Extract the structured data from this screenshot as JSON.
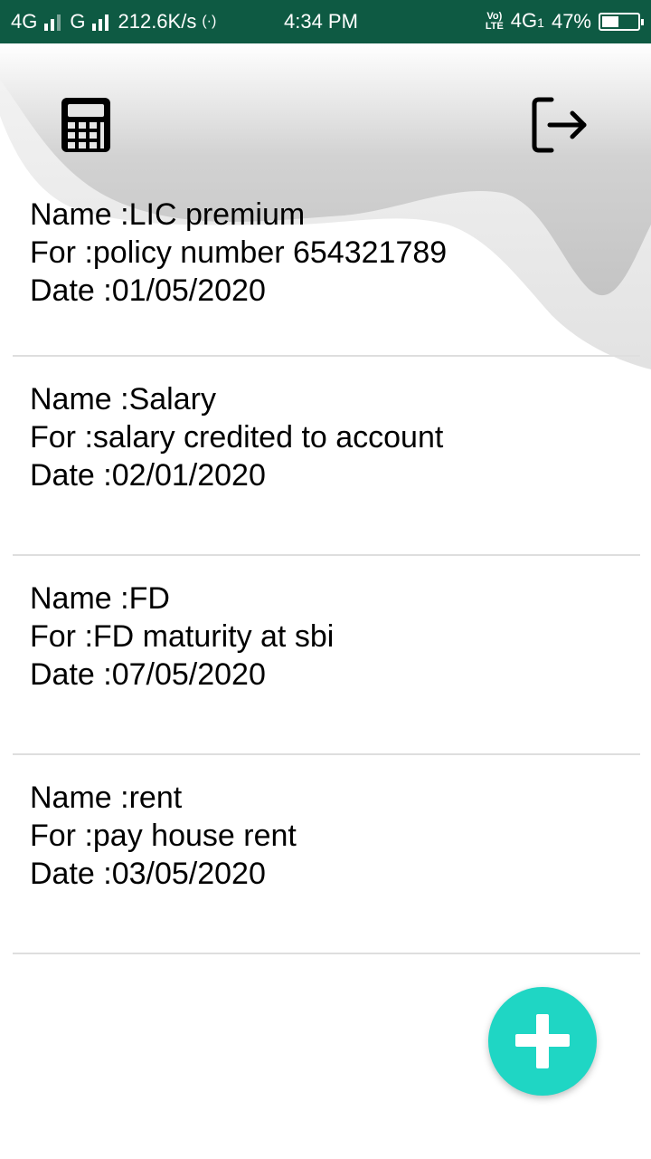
{
  "status_bar": {
    "left_network_1": "4G",
    "left_network_2": "G",
    "speed": "212.6K/s",
    "hotspot": "(·)",
    "time": "4:34 PM",
    "volte_top": "Vo)",
    "volte_bottom": "LTE",
    "right_network": "4G",
    "sim_index": "1",
    "battery": "47%"
  },
  "toolbar": {
    "calculator_icon": "calculator-icon",
    "logout_icon": "logout-icon"
  },
  "reminders": [
    {
      "name_line": "Name :LIC premium",
      "for_line": "For :policy number 654321789",
      "date_line": "Date :01/05/2020"
    },
    {
      "name_line": "Name :Salary",
      "for_line": "For :salary credited to account",
      "date_line": "Date :02/01/2020"
    },
    {
      "name_line": "Name :FD",
      "for_line": "For :FD maturity at sbi",
      "date_line": "Date :07/05/2020"
    },
    {
      "name_line": "Name :rent",
      "for_line": "For :pay house rent",
      "date_line": "Date :03/05/2020"
    }
  ],
  "fab": {
    "icon": "plus-icon"
  },
  "colors": {
    "status_bar": "#0e5a43",
    "fab": "#1fd6c4",
    "divider": "#dedede"
  }
}
